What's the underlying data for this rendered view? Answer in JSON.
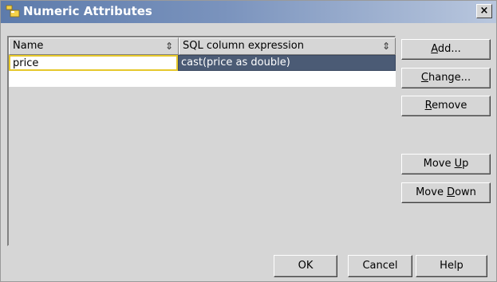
{
  "window": {
    "title": "Numeric Attributes",
    "close_label": "×"
  },
  "table": {
    "columns": [
      {
        "label": "Name",
        "sort_icon": "⇕"
      },
      {
        "label": "SQL column expression",
        "sort_icon": "⇕"
      }
    ],
    "rows": [
      {
        "name": "price",
        "expression": "cast(price as double)"
      }
    ]
  },
  "side_buttons": {
    "add": {
      "mnemonic": "A",
      "rest": "dd..."
    },
    "change": {
      "mnemonic": "C",
      "rest": "hange..."
    },
    "remove": {
      "mnemonic": "R",
      "rest": "emove"
    },
    "move_up": {
      "pre": "Move ",
      "mnemonic": "U",
      "rest": "p"
    },
    "move_down": {
      "pre": "Move ",
      "mnemonic": "D",
      "rest": "own"
    }
  },
  "bottom_buttons": {
    "ok": "OK",
    "cancel": "Cancel",
    "help": "Help"
  },
  "colors": {
    "selection": "#4b5b75",
    "focus_border": "#e6c82a",
    "titlebar_start": "#5d7bab",
    "titlebar_end": "#b9c7de"
  }
}
